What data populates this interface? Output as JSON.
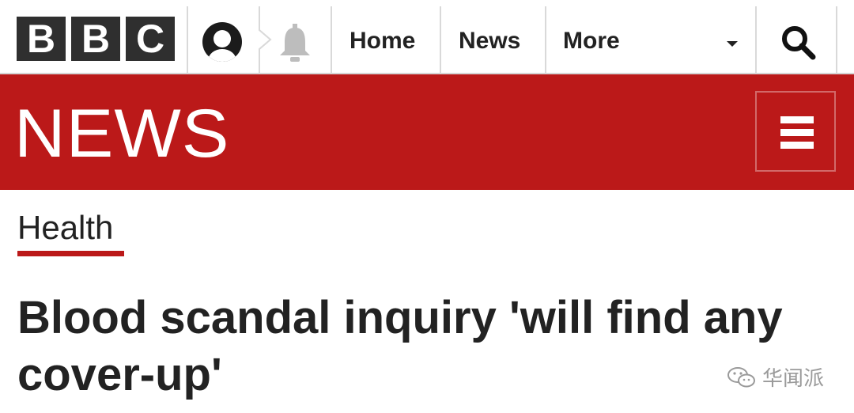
{
  "topnav": {
    "logo_letters": [
      "B",
      "B",
      "C"
    ],
    "links": [
      {
        "label": "Home"
      },
      {
        "label": "News"
      },
      {
        "label": "More"
      }
    ],
    "icons": [
      "account-icon",
      "notification-bell-icon",
      "dropdown-caret-icon",
      "search-icon"
    ]
  },
  "banner": {
    "title": "NEWS",
    "menu_icon": "hamburger-menu-icon",
    "color": "#bb1919"
  },
  "article": {
    "section": "Health",
    "headline": "Blood scandal inquiry 'will find any cover-up'"
  },
  "watermark": {
    "text": "华闻派",
    "icon": "wechat-icon"
  }
}
